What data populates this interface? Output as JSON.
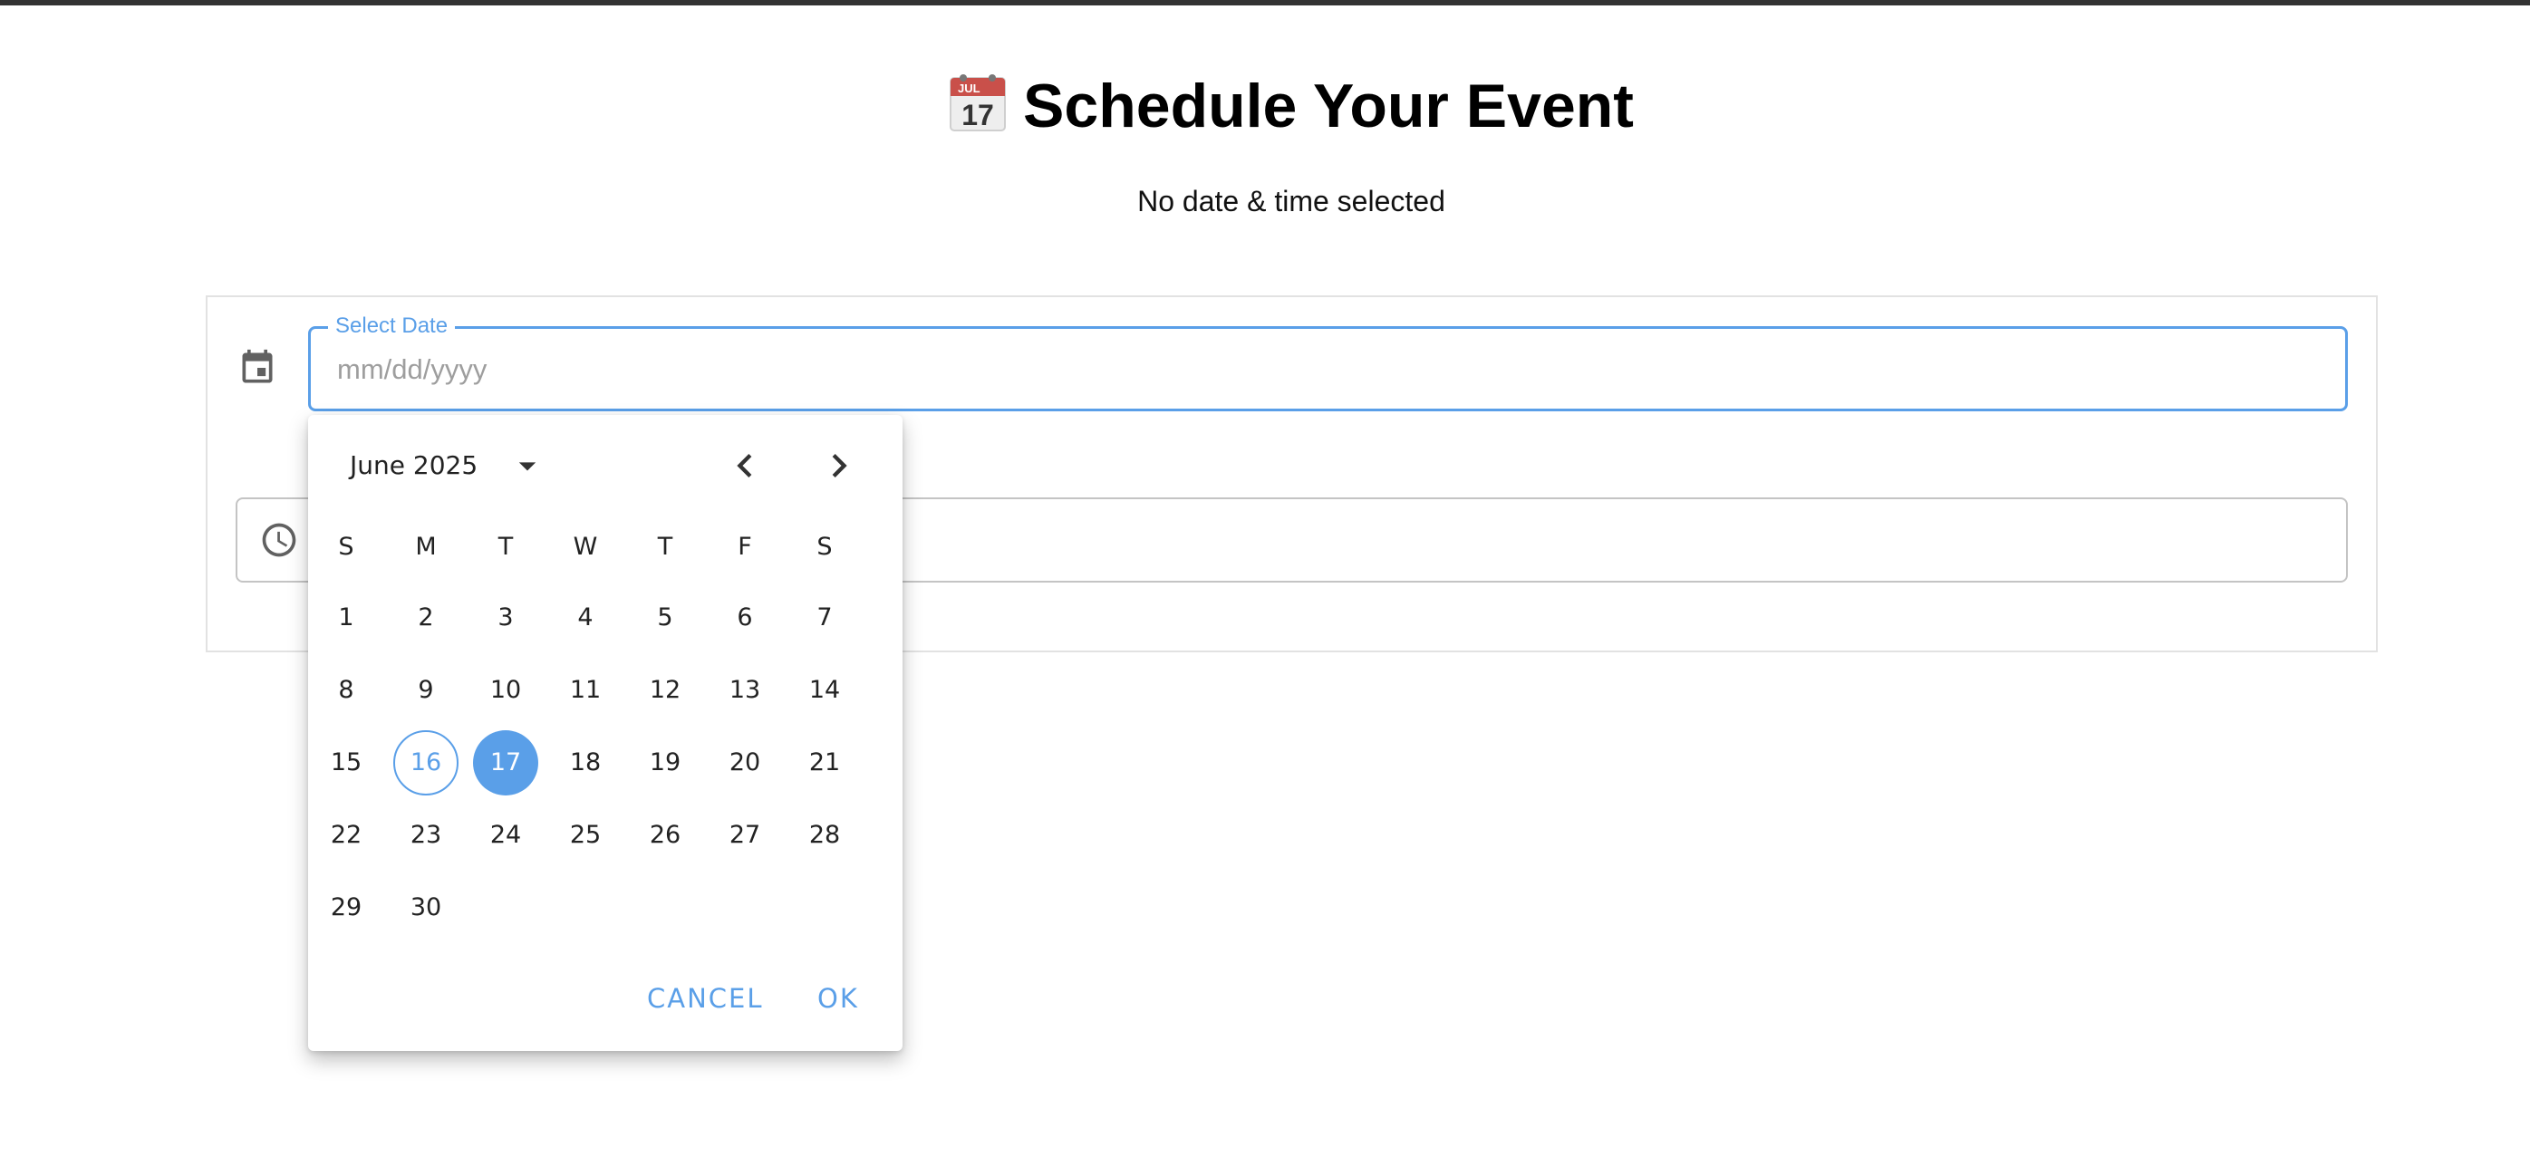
{
  "page": {
    "title": "Schedule Your Event",
    "title_icon": "calendar-emoji",
    "status": "No date & time selected"
  },
  "date_field": {
    "label": "Select Date",
    "placeholder": "mm/dd/yyyy",
    "value": "",
    "icon": "calendar-icon"
  },
  "time_field": {
    "icon": "clock-icon",
    "value": ""
  },
  "date_picker": {
    "month_label": "June 2025",
    "weekdays": [
      "S",
      "M",
      "T",
      "W",
      "T",
      "F",
      "S"
    ],
    "days": [
      "1",
      "2",
      "3",
      "4",
      "5",
      "6",
      "7",
      "8",
      "9",
      "10",
      "11",
      "12",
      "13",
      "14",
      "15",
      "16",
      "17",
      "18",
      "19",
      "20",
      "21",
      "22",
      "23",
      "24",
      "25",
      "26",
      "27",
      "28",
      "29",
      "30"
    ],
    "first_weekday_index": 0,
    "today": "16",
    "selected": "17",
    "cancel_label": "CANCEL",
    "ok_label": "OK"
  },
  "colors": {
    "accent": "#5a9fe8",
    "top_bar": "#333333",
    "text": "#222222",
    "placeholder": "#9e9e9e",
    "border": "#c4c4c4"
  }
}
